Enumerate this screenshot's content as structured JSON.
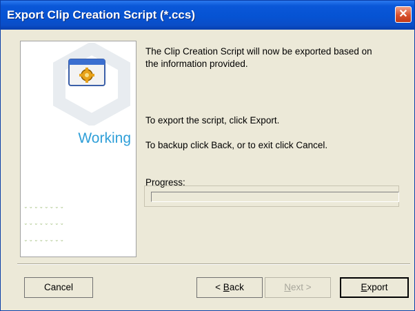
{
  "window": {
    "title": "Export Clip Creation Script (*.ccs)",
    "close_glyph": "✕",
    "close_icon": "close-icon"
  },
  "side_panel": {
    "status_label": "Working",
    "icon": "gear-window-icon",
    "dot_rows": [
      "˘ ˘ ˘ ˘ ˘ ˘ ˘ ˘",
      "˘ ˘ ˘ ˘ ˘ ˘ ˘ ˘",
      "˘ ˘ ˘ ˘ ˘ ˘ ˘ ˘"
    ]
  },
  "content": {
    "intro_line1": "The Clip Creation Script will now be exported based on",
    "intro_line2": "the information provided.",
    "export_instruction": "To export the script, click Export.",
    "back_instruction": "To backup click Back, or to exit click Cancel."
  },
  "progress": {
    "label": "Progress:",
    "value": 0
  },
  "buttons": {
    "cancel": "Cancel",
    "back_prefix": "< ",
    "back_mnemonic": "B",
    "back_rest": "ack",
    "next_mnemonic": "N",
    "next_rest": "ext >",
    "export_mnemonic": "E",
    "export_rest": "xport"
  },
  "colors": {
    "title_bar": "#0a55d6",
    "accent_text": "#2f9fd8",
    "dialog_bg": "#ece9d8"
  }
}
